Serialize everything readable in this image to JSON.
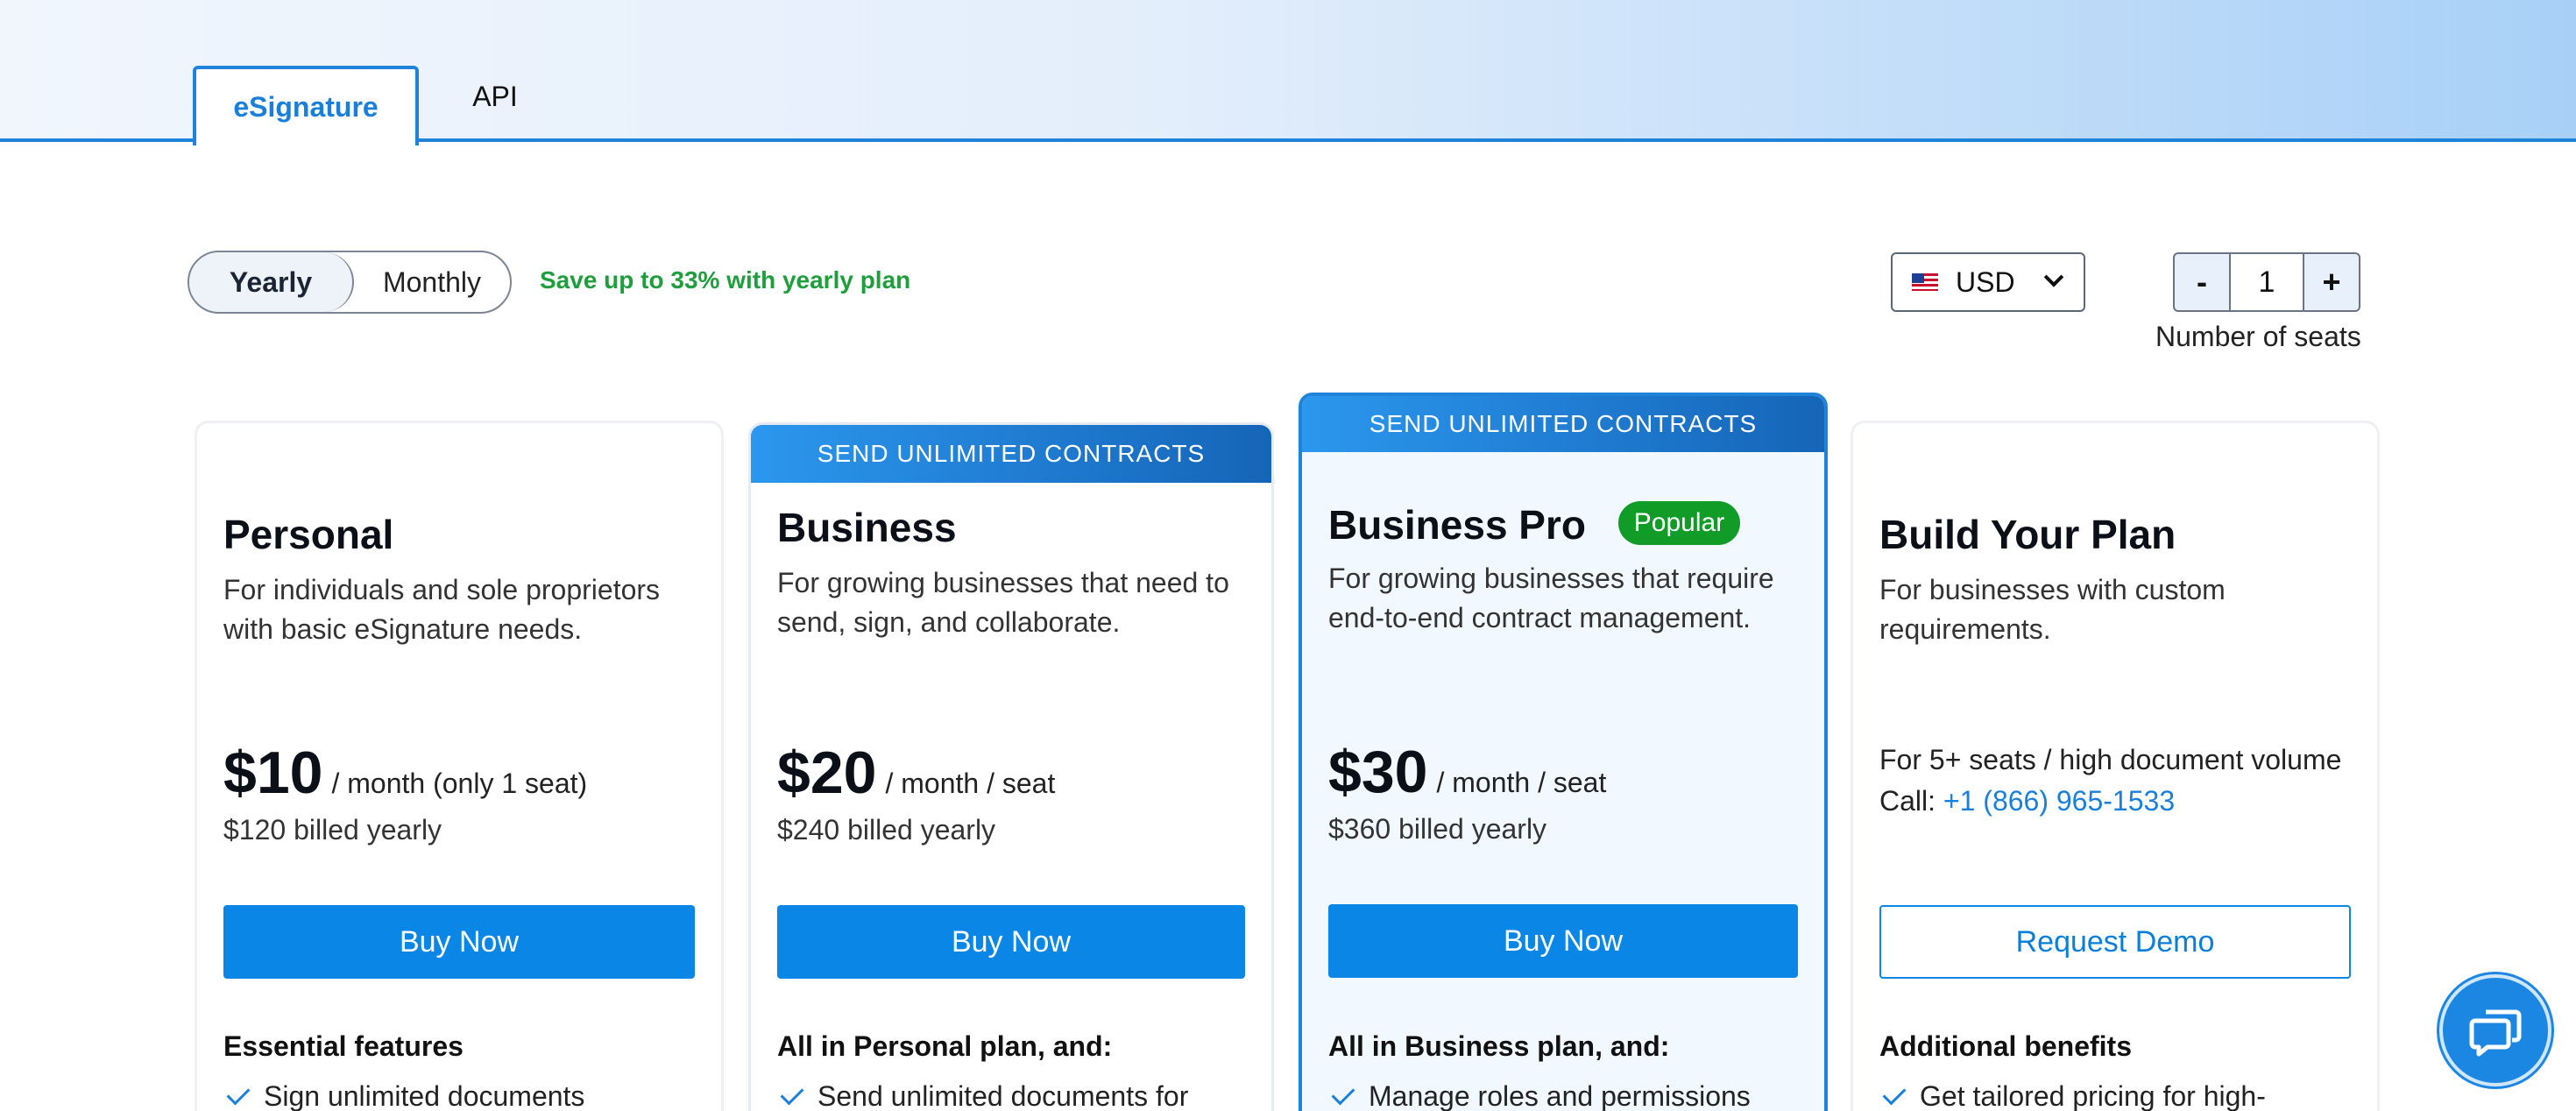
{
  "tabs": [
    {
      "label": "eSignature",
      "active": true
    },
    {
      "label": "API",
      "active": false
    }
  ],
  "billing": {
    "yearly_label": "Yearly",
    "monthly_label": "Monthly",
    "selected": "Yearly",
    "save_note": "Save up to 33% with yearly plan"
  },
  "currency": {
    "code": "USD",
    "flag_icon": "us-flag-icon"
  },
  "seats": {
    "minus": "-",
    "value": "1",
    "plus": "+",
    "label": "Number of seats"
  },
  "plans": [
    {
      "name": "Personal",
      "description": "For individuals and sole proprietors with basic eSignature needs.",
      "price": "$10",
      "per": "/ month (only 1 seat)",
      "billed": "$120 billed yearly",
      "cta": "Buy Now",
      "features_heading": "Essential features",
      "features": [
        "Sign unlimited documents"
      ]
    },
    {
      "banner": "SEND UNLIMITED CONTRACTS",
      "name": "Business",
      "description": "For growing businesses that need to send, sign, and collaborate.",
      "price": "$20",
      "per": "/ month / seat",
      "billed": "$240 billed yearly",
      "cta": "Buy Now",
      "features_heading": "All in Personal plan, and:",
      "features": [
        "Send unlimited documents for"
      ]
    },
    {
      "banner": "SEND UNLIMITED CONTRACTS",
      "name": "Business Pro",
      "badge": "Popular",
      "description": "For growing businesses that require end-to-end contract management.",
      "price": "$30",
      "per": "/ month / seat",
      "billed": "$360 billed yearly",
      "cta": "Buy Now",
      "features_heading": "All in Business plan, and:",
      "features": [
        "Manage roles and permissions"
      ]
    },
    {
      "name": "Build Your Plan",
      "description": "For businesses with custom requirements.",
      "volume": "For 5+ seats / high document volume",
      "call_label": "Call:",
      "phone": "+1 (866) 965-1533",
      "cta": "Request Demo",
      "features_heading": "Additional benefits",
      "features": [
        "Get tailored pricing for high-"
      ]
    }
  ],
  "colors": {
    "accent": "#0a87e6",
    "popular_badge": "#119b27",
    "save_note": "#1e9e3d"
  }
}
